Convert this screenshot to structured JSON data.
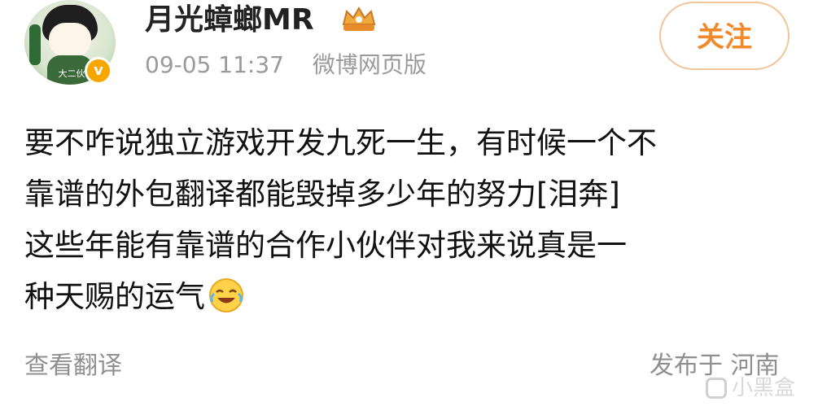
{
  "post": {
    "username": "月光蟑螂MR",
    "timestamp": "09-05 11:37",
    "source": "微博网页版",
    "follow_label": "关注",
    "content_lines": [
      "要不咋说独立游戏开发九死一生，有时候一个不",
      "靠谱的外包翻译都能毁掉多少年的努力[泪奔]",
      "这些年能有靠谱的合作小伙伴对我来说真是一",
      "种天赐的运气"
    ],
    "translate_label": "查看翻译",
    "location": "发布于 河南",
    "avatar_caption": "大二伙",
    "verified_mark": "v"
  },
  "watermark": {
    "text": "小黑盒"
  },
  "colors": {
    "accent_orange": "#f08a2a",
    "follow_border": "#f2c49a",
    "meta_gray": "#9a9a9a"
  },
  "icons": {
    "badge": "crown-badge-icon",
    "emoji": "laugh-cry-emoji-icon",
    "verified": "verified-v-icon",
    "watermark": "heybox-logo-icon"
  }
}
